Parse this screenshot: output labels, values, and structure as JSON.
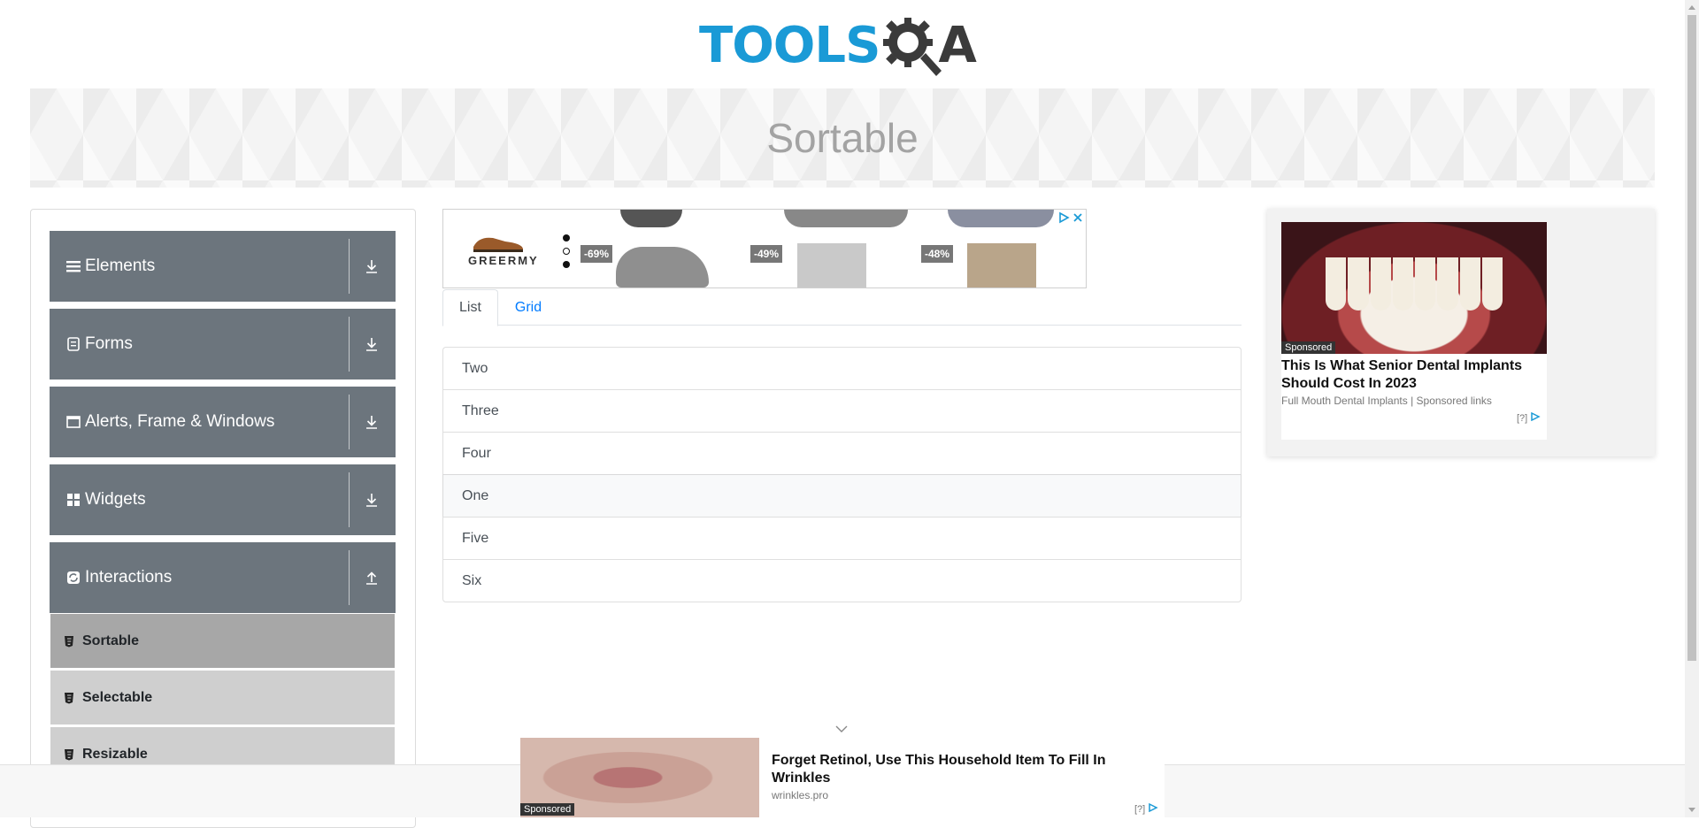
{
  "logo": {
    "part1": "TOOLS",
    "part2": "A"
  },
  "banner": {
    "title": "Sortable"
  },
  "sidebar": {
    "groups": [
      {
        "label": "Elements",
        "icon": "list-icon",
        "expanded": false
      },
      {
        "label": "Forms",
        "icon": "form-icon",
        "expanded": false
      },
      {
        "label": "Alerts, Frame & Windows",
        "icon": "window-icon",
        "expanded": false
      },
      {
        "label": "Widgets",
        "icon": "widgets-icon",
        "expanded": false
      },
      {
        "label": "Interactions",
        "icon": "interactions-icon",
        "expanded": true
      }
    ],
    "sub_items": [
      {
        "label": "Sortable",
        "active": true
      },
      {
        "label": "Selectable",
        "active": false
      },
      {
        "label": "Resizable",
        "active": false
      }
    ]
  },
  "top_ad": {
    "brand": "GREERMY",
    "discounts": [
      "-69%",
      "-49%",
      "-48%"
    ]
  },
  "tabs": [
    {
      "label": "List",
      "active": true
    },
    {
      "label": "Grid",
      "active": false
    }
  ],
  "sortable_list": [
    "Two",
    "Three",
    "Four",
    "One",
    "Five",
    "Six"
  ],
  "right_ad": {
    "tag": "Sponsored",
    "headline": "This Is What Senior Dental Implants Should Cost In 2023",
    "source": "Full Mouth Dental Implants | Sponsored links",
    "adchoice": "[?]"
  },
  "bottom_ad": {
    "tag": "Sponsored",
    "headline": "Forget Retinol, Use This Household Item To Fill In Wrinkles",
    "source": "wrinkles.pro",
    "adchoice": "[?]"
  },
  "colors": {
    "brand_blue": "#1a9ad6",
    "sidebar_group": "#6c757d",
    "sub_item": "#cfcfcf",
    "sub_item_active": "#a7a7a7",
    "link": "#007bff"
  }
}
